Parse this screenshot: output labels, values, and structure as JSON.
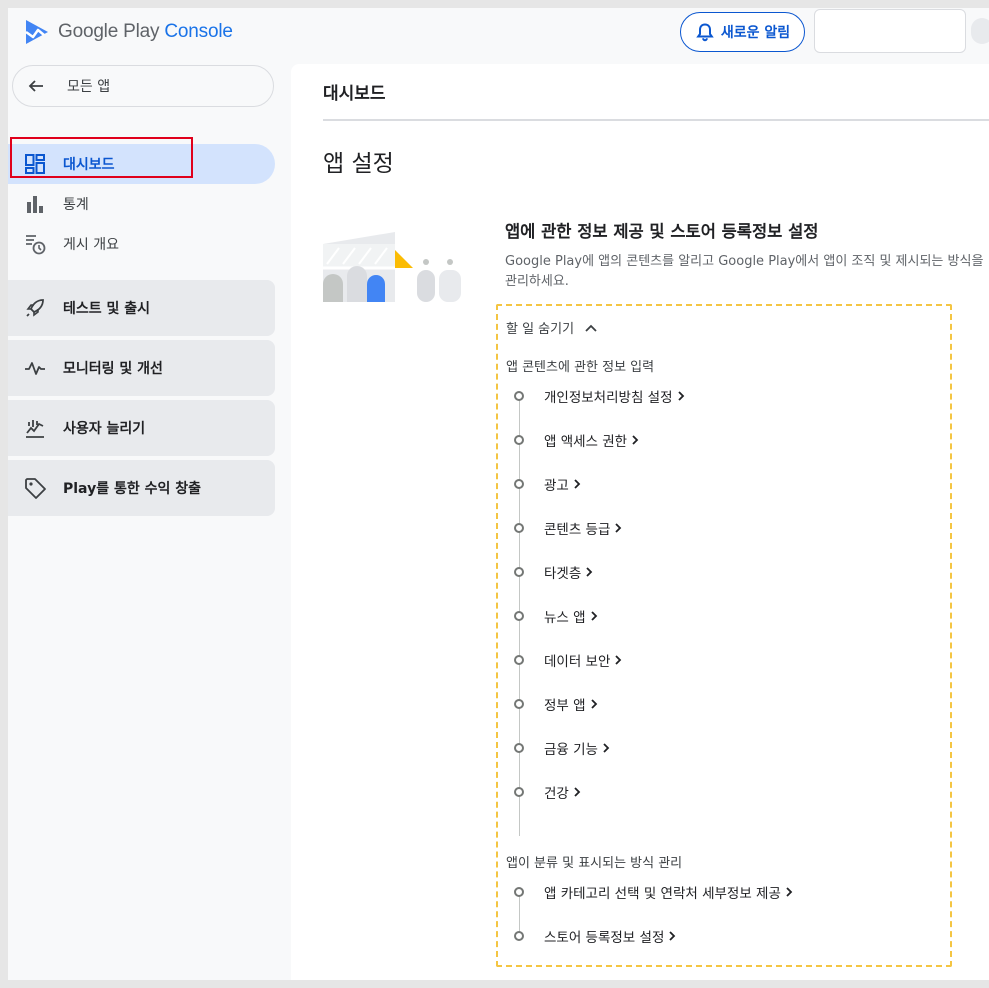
{
  "header": {
    "logo_text_1": "Google Play",
    "logo_text_2": "Console",
    "notify_label": "새로운 알림"
  },
  "sidebar": {
    "back_label": "모든 앱",
    "items": [
      {
        "label": "대시보드",
        "icon": "dashboard-icon"
      },
      {
        "label": "통계",
        "icon": "bar-chart-icon"
      },
      {
        "label": "게시 개요",
        "icon": "publishing-overview-icon"
      }
    ],
    "sections": [
      {
        "label": "테스트 및 출시",
        "icon": "rocket-icon"
      },
      {
        "label": "모니터링 및 개선",
        "icon": "monitoring-icon"
      },
      {
        "label": "사용자 늘리기",
        "icon": "grow-users-icon"
      },
      {
        "label": "Play를 통한 수익 창출",
        "icon": "tag-icon"
      }
    ]
  },
  "main": {
    "page_title": "대시보드",
    "section_title": "앱 설정",
    "card": {
      "title": "앱에 관한 정보 제공 및 스토어 등록정보 설정",
      "desc": "Google Play에 앱의 콘텐츠를 알리고 Google Play에서 앱이 조직 및 제시되는 방식을 관리하세요.",
      "hide_label": "할 일 숨기기",
      "group1_label": "앱 콘텐츠에 관한 정보 입력",
      "group1_tasks": [
        "개인정보처리방침 설정",
        "앱 액세스 권한",
        "광고",
        "콘텐츠 등급",
        "타겟층",
        "뉴스 앱",
        "데이터 보안",
        "정부 앱",
        "금융 기능",
        "건강"
      ],
      "group2_label": "앱이 분류 및 표시되는 방식 관리",
      "group2_tasks": [
        "앱 카테고리 선택 및 연락처 세부정보 제공",
        "스토어 등록정보 설정"
      ]
    }
  },
  "colors": {
    "accent": "#0b57d0",
    "active_bg": "#d3e3fd",
    "highlight": "#e0001b",
    "dashed_border": "#f4c542"
  }
}
